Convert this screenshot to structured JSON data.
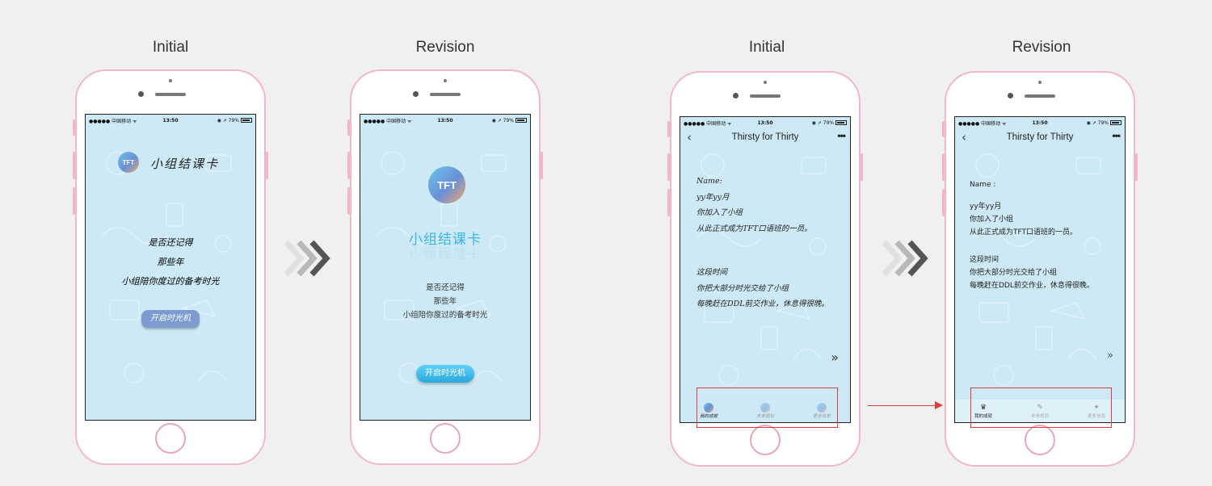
{
  "labels": {
    "initial": "Initial",
    "revision": "Revision"
  },
  "status_bar": {
    "carrier": "●●●●● 中国移动 ᯤ",
    "time": "13:50",
    "battery": "◉ ➚ 79%"
  },
  "card_screen": {
    "initial": {
      "title": "小组结课卡",
      "lines": [
        "是否还记得",
        "那些年",
        "小组陪你度过的备考时光"
      ],
      "button": "开启时光机"
    },
    "revision": {
      "logo": "TFT",
      "title": "小组结课卡",
      "lines": [
        "是否还记得",
        "那些年",
        "小组陪你度过的备考时光"
      ],
      "button": "开启时光机"
    }
  },
  "letter_screen": {
    "nav_title": "Thirsty for Thirty",
    "initial": {
      "paragraph1": [
        "Name:",
        "yy年yy月",
        "你加入了小组",
        "从此正式成为TFT口语班的一员。"
      ],
      "paragraph2": [
        "这段时间",
        "你把大部分时光交给了小组",
        "每晚赶在DDL前交作业，休息得很晚。"
      ],
      "next": "»",
      "tabs": [
        "我的成就",
        "未来规划",
        "更多信息"
      ]
    },
    "revision": {
      "paragraph1": [
        "Name :",
        "yy年yy月",
        "你加入了小组",
        "从此正式成为TFT口语班的一员。"
      ],
      "paragraph2": [
        "这段时间",
        "你把大部分时光交给了小组",
        "每晚赶在DDL前交作业，休息得很晚。"
      ],
      "next": "»",
      "tabs": [
        "我的成就",
        "未来规划",
        "更多信息"
      ]
    }
  },
  "colors": {
    "phone_border": "#f2b8c6",
    "screen_bg": "#cde9f5",
    "accent": "#3bb6e8",
    "highlight": "#e23b3b"
  },
  "icons": {
    "back": "‹",
    "more": "•••",
    "trophy": "🏆",
    "notepad": "📝",
    "wand": "✨"
  }
}
